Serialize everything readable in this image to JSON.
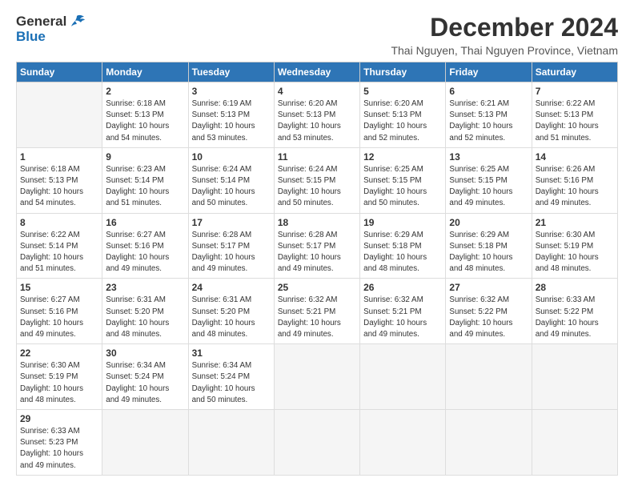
{
  "header": {
    "logo_line1": "General",
    "logo_line2": "Blue",
    "title": "December 2024",
    "subtitle": "Thai Nguyen, Thai Nguyen Province, Vietnam"
  },
  "calendar": {
    "days_of_week": [
      "Sunday",
      "Monday",
      "Tuesday",
      "Wednesday",
      "Thursday",
      "Friday",
      "Saturday"
    ],
    "weeks": [
      [
        {
          "day": "",
          "info": ""
        },
        {
          "day": "2",
          "info": "Sunrise: 6:18 AM\nSunset: 5:13 PM\nDaylight: 10 hours\nand 54 minutes."
        },
        {
          "day": "3",
          "info": "Sunrise: 6:19 AM\nSunset: 5:13 PM\nDaylight: 10 hours\nand 53 minutes."
        },
        {
          "day": "4",
          "info": "Sunrise: 6:20 AM\nSunset: 5:13 PM\nDaylight: 10 hours\nand 53 minutes."
        },
        {
          "day": "5",
          "info": "Sunrise: 6:20 AM\nSunset: 5:13 PM\nDaylight: 10 hours\nand 52 minutes."
        },
        {
          "day": "6",
          "info": "Sunrise: 6:21 AM\nSunset: 5:13 PM\nDaylight: 10 hours\nand 52 minutes."
        },
        {
          "day": "7",
          "info": "Sunrise: 6:22 AM\nSunset: 5:13 PM\nDaylight: 10 hours\nand 51 minutes."
        }
      ],
      [
        {
          "day": "1",
          "info": "Sunrise: 6:18 AM\nSunset: 5:13 PM\nDaylight: 10 hours\nand 54 minutes."
        },
        {
          "day": "9",
          "info": "Sunrise: 6:23 AM\nSunset: 5:14 PM\nDaylight: 10 hours\nand 51 minutes."
        },
        {
          "day": "10",
          "info": "Sunrise: 6:24 AM\nSunset: 5:14 PM\nDaylight: 10 hours\nand 50 minutes."
        },
        {
          "day": "11",
          "info": "Sunrise: 6:24 AM\nSunset: 5:15 PM\nDaylight: 10 hours\nand 50 minutes."
        },
        {
          "day": "12",
          "info": "Sunrise: 6:25 AM\nSunset: 5:15 PM\nDaylight: 10 hours\nand 50 minutes."
        },
        {
          "day": "13",
          "info": "Sunrise: 6:25 AM\nSunset: 5:15 PM\nDaylight: 10 hours\nand 49 minutes."
        },
        {
          "day": "14",
          "info": "Sunrise: 6:26 AM\nSunset: 5:16 PM\nDaylight: 10 hours\nand 49 minutes."
        }
      ],
      [
        {
          "day": "8",
          "info": "Sunrise: 6:22 AM\nSunset: 5:14 PM\nDaylight: 10 hours\nand 51 minutes."
        },
        {
          "day": "16",
          "info": "Sunrise: 6:27 AM\nSunset: 5:16 PM\nDaylight: 10 hours\nand 49 minutes."
        },
        {
          "day": "17",
          "info": "Sunrise: 6:28 AM\nSunset: 5:17 PM\nDaylight: 10 hours\nand 49 minutes."
        },
        {
          "day": "18",
          "info": "Sunrise: 6:28 AM\nSunset: 5:17 PM\nDaylight: 10 hours\nand 49 minutes."
        },
        {
          "day": "19",
          "info": "Sunrise: 6:29 AM\nSunset: 5:18 PM\nDaylight: 10 hours\nand 48 minutes."
        },
        {
          "day": "20",
          "info": "Sunrise: 6:29 AM\nSunset: 5:18 PM\nDaylight: 10 hours\nand 48 minutes."
        },
        {
          "day": "21",
          "info": "Sunrise: 6:30 AM\nSunset: 5:19 PM\nDaylight: 10 hours\nand 48 minutes."
        }
      ],
      [
        {
          "day": "15",
          "info": "Sunrise: 6:27 AM\nSunset: 5:16 PM\nDaylight: 10 hours\nand 49 minutes."
        },
        {
          "day": "23",
          "info": "Sunrise: 6:31 AM\nSunset: 5:20 PM\nDaylight: 10 hours\nand 48 minutes."
        },
        {
          "day": "24",
          "info": "Sunrise: 6:31 AM\nSunset: 5:20 PM\nDaylight: 10 hours\nand 48 minutes."
        },
        {
          "day": "25",
          "info": "Sunrise: 6:32 AM\nSunset: 5:21 PM\nDaylight: 10 hours\nand 49 minutes."
        },
        {
          "day": "26",
          "info": "Sunrise: 6:32 AM\nSunset: 5:21 PM\nDaylight: 10 hours\nand 49 minutes."
        },
        {
          "day": "27",
          "info": "Sunrise: 6:32 AM\nSunset: 5:22 PM\nDaylight: 10 hours\nand 49 minutes."
        },
        {
          "day": "28",
          "info": "Sunrise: 6:33 AM\nSunset: 5:22 PM\nDaylight: 10 hours\nand 49 minutes."
        }
      ],
      [
        {
          "day": "22",
          "info": "Sunrise: 6:30 AM\nSunset: 5:19 PM\nDaylight: 10 hours\nand 48 minutes."
        },
        {
          "day": "30",
          "info": "Sunrise: 6:34 AM\nSunset: 5:24 PM\nDaylight: 10 hours\nand 49 minutes."
        },
        {
          "day": "31",
          "info": "Sunrise: 6:34 AM\nSunset: 5:24 PM\nDaylight: 10 hours\nand 50 minutes."
        },
        {
          "day": "",
          "info": ""
        },
        {
          "day": "",
          "info": ""
        },
        {
          "day": "",
          "info": ""
        },
        {
          "day": "",
          "info": ""
        }
      ],
      [
        {
          "day": "29",
          "info": "Sunrise: 6:33 AM\nSunset: 5:23 PM\nDaylight: 10 hours\nand 49 minutes."
        },
        {
          "day": "",
          "info": ""
        },
        {
          "day": "",
          "info": ""
        },
        {
          "day": "",
          "info": ""
        },
        {
          "day": "",
          "info": ""
        },
        {
          "day": "",
          "info": ""
        },
        {
          "day": "",
          "info": ""
        }
      ]
    ]
  }
}
